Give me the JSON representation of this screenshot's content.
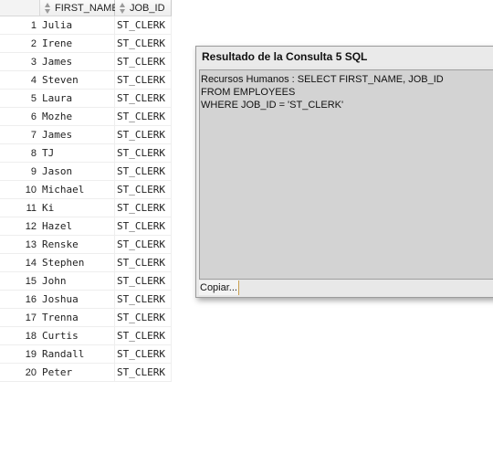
{
  "grid": {
    "columns": [
      "FIRST_NAME",
      "JOB_ID"
    ],
    "rows": [
      {
        "num": "1",
        "first_name": "Julia",
        "job_id": "ST_CLERK"
      },
      {
        "num": "2",
        "first_name": "Irene",
        "job_id": "ST_CLERK"
      },
      {
        "num": "3",
        "first_name": "James",
        "job_id": "ST_CLERK"
      },
      {
        "num": "4",
        "first_name": "Steven",
        "job_id": "ST_CLERK"
      },
      {
        "num": "5",
        "first_name": "Laura",
        "job_id": "ST_CLERK"
      },
      {
        "num": "6",
        "first_name": "Mozhe",
        "job_id": "ST_CLERK"
      },
      {
        "num": "7",
        "first_name": "James",
        "job_id": "ST_CLERK"
      },
      {
        "num": "8",
        "first_name": "TJ",
        "job_id": "ST_CLERK"
      },
      {
        "num": "9",
        "first_name": "Jason",
        "job_id": "ST_CLERK"
      },
      {
        "num": "10",
        "first_name": "Michael",
        "job_id": "ST_CLERK"
      },
      {
        "num": "11",
        "first_name": "Ki",
        "job_id": "ST_CLERK"
      },
      {
        "num": "12",
        "first_name": "Hazel",
        "job_id": "ST_CLERK"
      },
      {
        "num": "13",
        "first_name": "Renske",
        "job_id": "ST_CLERK"
      },
      {
        "num": "14",
        "first_name": "Stephen",
        "job_id": "ST_CLERK"
      },
      {
        "num": "15",
        "first_name": "John",
        "job_id": "ST_CLERK"
      },
      {
        "num": "16",
        "first_name": "Joshua",
        "job_id": "ST_CLERK"
      },
      {
        "num": "17",
        "first_name": "Trenna",
        "job_id": "ST_CLERK"
      },
      {
        "num": "18",
        "first_name": "Curtis",
        "job_id": "ST_CLERK"
      },
      {
        "num": "19",
        "first_name": "Randall",
        "job_id": "ST_CLERK"
      },
      {
        "num": "20",
        "first_name": "Peter",
        "job_id": "ST_CLERK"
      }
    ]
  },
  "dialog": {
    "title": "Resultado de la Consulta 5 SQL",
    "sql_lines": [
      "Recursos Humanos : SELECT FIRST_NAME, JOB_ID",
      "FROM EMPLOYEES",
      "WHERE JOB_ID = 'ST_CLERK'"
    ],
    "copy_label": "Copiar..."
  }
}
